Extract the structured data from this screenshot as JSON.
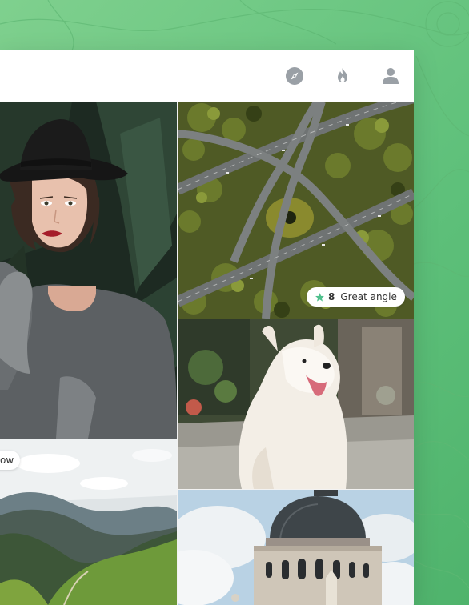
{
  "header": {
    "icons": [
      "compass-icon",
      "flame-icon",
      "user-icon"
    ]
  },
  "photos": {
    "woman": {
      "subject": "woman-portrait"
    },
    "highway": {
      "subject": "highway-aerial",
      "badge": {
        "icon": "star-icon",
        "count": "8",
        "label": "Great angle"
      }
    },
    "dog": {
      "subject": "white-dog"
    },
    "mountains": {
      "subject": "mountain-valley",
      "badge": {
        "label": "ow"
      }
    },
    "building": {
      "subject": "domed-building"
    }
  },
  "colors": {
    "background": "#6cc683",
    "accent_star": "#4fc08d",
    "icon_gray": "#9aa0a6"
  }
}
